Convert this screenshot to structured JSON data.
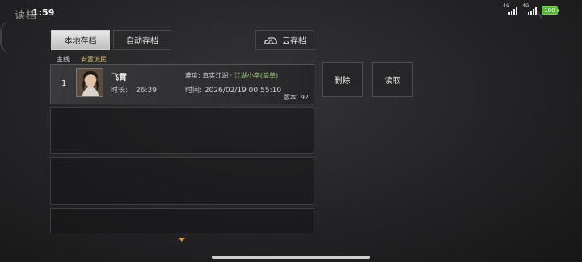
{
  "status_bar": {
    "title": "读档",
    "time": "1:59",
    "net1": "4G",
    "net2": "4G",
    "battery": "100"
  },
  "tabs": {
    "local": "本地存档",
    "auto": "自动存档",
    "cloud": "云存档"
  },
  "section": {
    "main_label": "主线",
    "sub_label": "安置流民"
  },
  "save_slot": {
    "index": "1",
    "name": "飞霄",
    "playtime_label": "时长:",
    "playtime": "26:39",
    "difficulty_label": "难度: 真实江湖 · ",
    "difficulty_mode": "江湖小卒(简单)",
    "time_label": "时间:",
    "save_time": "2026/02/19 00:55:10",
    "version_label": "版本.",
    "version": "92"
  },
  "actions": {
    "delete": "删除",
    "load": "读取"
  },
  "icons": {
    "cloud": "cloud-sync-icon",
    "more": "chevron-down-icon"
  },
  "colors": {
    "accent_gold": "#e3c77a",
    "difficulty_green": "#9ec27a",
    "arrow_orange": "#e79a2b"
  }
}
